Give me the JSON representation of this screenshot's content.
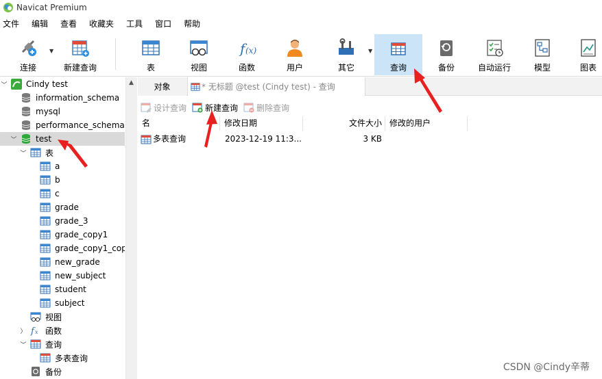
{
  "window": {
    "title": "Navicat Premium"
  },
  "menu": [
    "文件",
    "编辑",
    "查看",
    "收藏夹",
    "工具",
    "窗口",
    "帮助"
  ],
  "toolbar": {
    "connect": "连接",
    "new_query": "新建查询",
    "table": "表",
    "view": "视图",
    "function": "函数",
    "user": "用户",
    "other": "其它",
    "query": "查询",
    "backup": "备份",
    "automation": "自动运行",
    "model": "模型",
    "chart": "图表"
  },
  "tree": {
    "connection": "Cindy test",
    "databases": [
      "information_schema",
      "mysql",
      "performance_schema",
      "test"
    ],
    "tables_label": "表",
    "tables": [
      "a",
      "b",
      "c",
      "grade",
      "grade_3",
      "grade_copy1",
      "grade_copy1_cop",
      "new_grade",
      "new_subject",
      "student",
      "subject"
    ],
    "views_label": "视图",
    "functions_label": "函数",
    "queries_label": "查询",
    "queries": [
      "多表查询"
    ],
    "backups_label": "备份"
  },
  "tabs": {
    "objects": "对象",
    "query_tab": "* 无标题 @test (Cindy test) - 查询"
  },
  "object_toolbar": {
    "design": "设计查询",
    "new": "新建查询",
    "delete": "删除查询"
  },
  "list": {
    "columns": [
      "名",
      "修改日期",
      "文件大小",
      "修改的用户"
    ],
    "rows": [
      {
        "name": "多表查询",
        "modified": "2023-12-19 11:3...",
        "size": "3 KB",
        "user": ""
      }
    ]
  },
  "watermark": "CSDN @Cindy辛蒂",
  "colors": {
    "accent": "#cce4f7",
    "arrow": "#e8201f",
    "selected": "#d9d9d9"
  }
}
